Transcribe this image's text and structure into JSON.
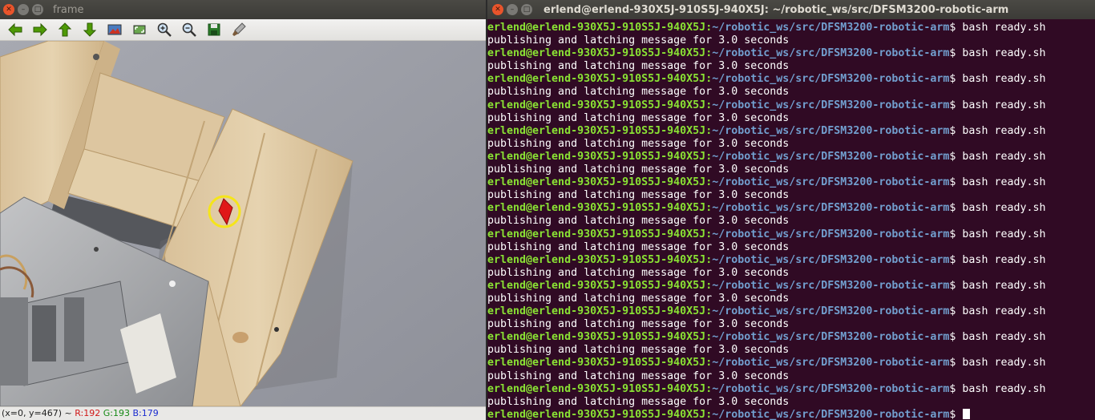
{
  "frame_window": {
    "title": "frame",
    "toolbar": [
      {
        "name": "pan-left-icon",
        "color": "#4e9a06"
      },
      {
        "name": "pan-right-icon",
        "color": "#4e9a06"
      },
      {
        "name": "pan-up-icon",
        "color": "#4e9a06"
      },
      {
        "name": "pan-down-icon",
        "color": "#4e9a06"
      },
      {
        "name": "zoom-x1-icon"
      },
      {
        "name": "zoom-fit-icon"
      },
      {
        "name": "zoom-in-icon"
      },
      {
        "name": "zoom-out-icon"
      },
      {
        "name": "save-icon",
        "color": "#2a7a2a"
      },
      {
        "name": "properties-icon"
      }
    ],
    "status": {
      "coords": "(x=0, y=467) ~",
      "r": "R:192",
      "g": "G:193",
      "b": "B:179"
    }
  },
  "terminal_window": {
    "title": "erlend@erlend-930X5J-910S5J-940X5J: ~/robotic_ws/src/DFSM3200-robotic-arm",
    "prompt_user": "erlend@erlend-930X5J-910S5J-940X5J",
    "prompt_path": "~/robotic_ws/src/DFSM3200-robotic-arm",
    "command": "bash ready.sh",
    "output": "publishing and latching message for 3.0 seconds",
    "repetitions": 15
  },
  "colors": {
    "terminal_bg": "#300a24",
    "prompt_user": "#8ae234",
    "prompt_path": "#729fcf",
    "marker_circle": "#f5e51a",
    "marker_object": "#e01818"
  }
}
